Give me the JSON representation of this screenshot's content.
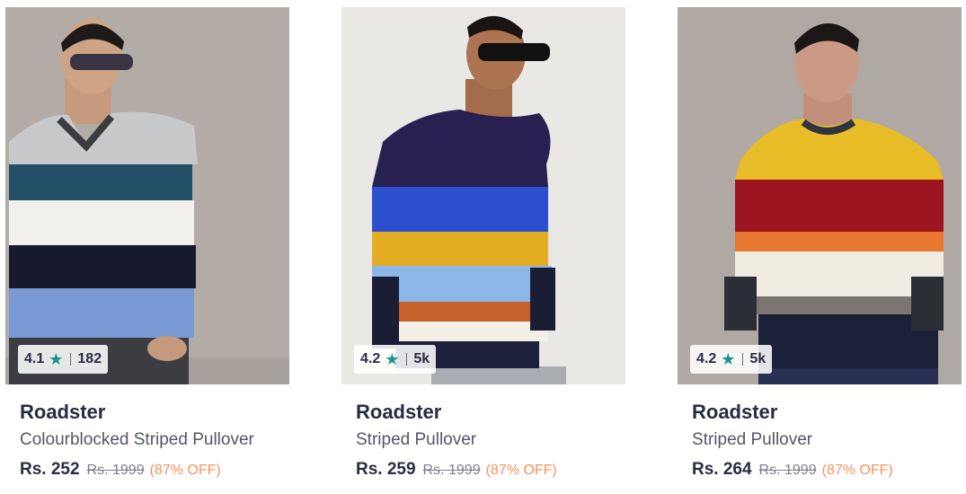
{
  "products": [
    {
      "rating": "4.1",
      "rating_count": "182",
      "star_icon": "star-icon",
      "brand": "Roadster",
      "title": "Colourblocked Striped Pullover",
      "price": "Rs. 252",
      "mrp": "Rs. 1999",
      "discount": "(87% OFF)"
    },
    {
      "rating": "4.2",
      "rating_count": "5k",
      "star_icon": "star-icon",
      "brand": "Roadster",
      "title": "Striped Pullover",
      "price": "Rs. 259",
      "mrp": "Rs. 1999",
      "discount": "(87% OFF)"
    },
    {
      "rating": "4.2",
      "rating_count": "5k",
      "star_icon": "star-icon",
      "brand": "Roadster",
      "title": "Striped Pullover",
      "price": "Rs. 264",
      "mrp": "Rs. 1999",
      "discount": "(87% OFF)"
    }
  ],
  "colors": {
    "star": "#14958f",
    "discount": "#ff905a",
    "brand_text": "#282c3f"
  }
}
